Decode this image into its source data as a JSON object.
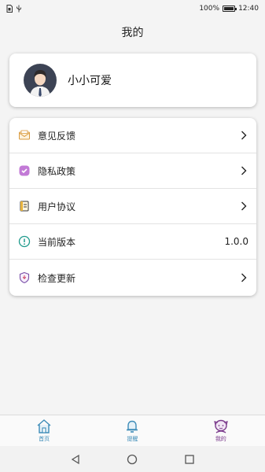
{
  "status_bar": {
    "battery_text": "100%",
    "battery_level": 1.0,
    "time": "12:40"
  },
  "header": {
    "title": "我的"
  },
  "profile": {
    "username": "小小可爱",
    "avatar_icon": "avatar-person-icon"
  },
  "menu": {
    "items": [
      {
        "label": "意见反馈",
        "icon": "feedback-envelope-icon",
        "icon_color": "#e0a24a"
      },
      {
        "label": "隐私政策",
        "icon": "privacy-shield-icon",
        "icon_color": "#b05fc8"
      },
      {
        "label": "用户协议",
        "icon": "agreement-document-icon",
        "icon_color": "#d8a235"
      },
      {
        "label": "当前版本",
        "icon": "info-circle-icon",
        "icon_color": "#1f9a8c",
        "value": "1.0.0"
      },
      {
        "label": "检查更新",
        "icon": "update-shield-icon",
        "icon_color": "#7a4fa8"
      }
    ]
  },
  "tab_bar": {
    "tabs": [
      {
        "label": "首页",
        "icon": "home-icon",
        "color": "#3d8cb8",
        "active": false
      },
      {
        "label": "提醒",
        "icon": "bell-icon",
        "color": "#3d8cb8",
        "active": false
      },
      {
        "label": "我的",
        "icon": "profile-face-icon",
        "color": "#7b3b8c",
        "active": true
      }
    ]
  },
  "colors": {
    "background": "#f4f4f4",
    "card": "#ffffff",
    "tab_inactive": "#3d8cb8",
    "tab_active": "#7b3b8c"
  }
}
